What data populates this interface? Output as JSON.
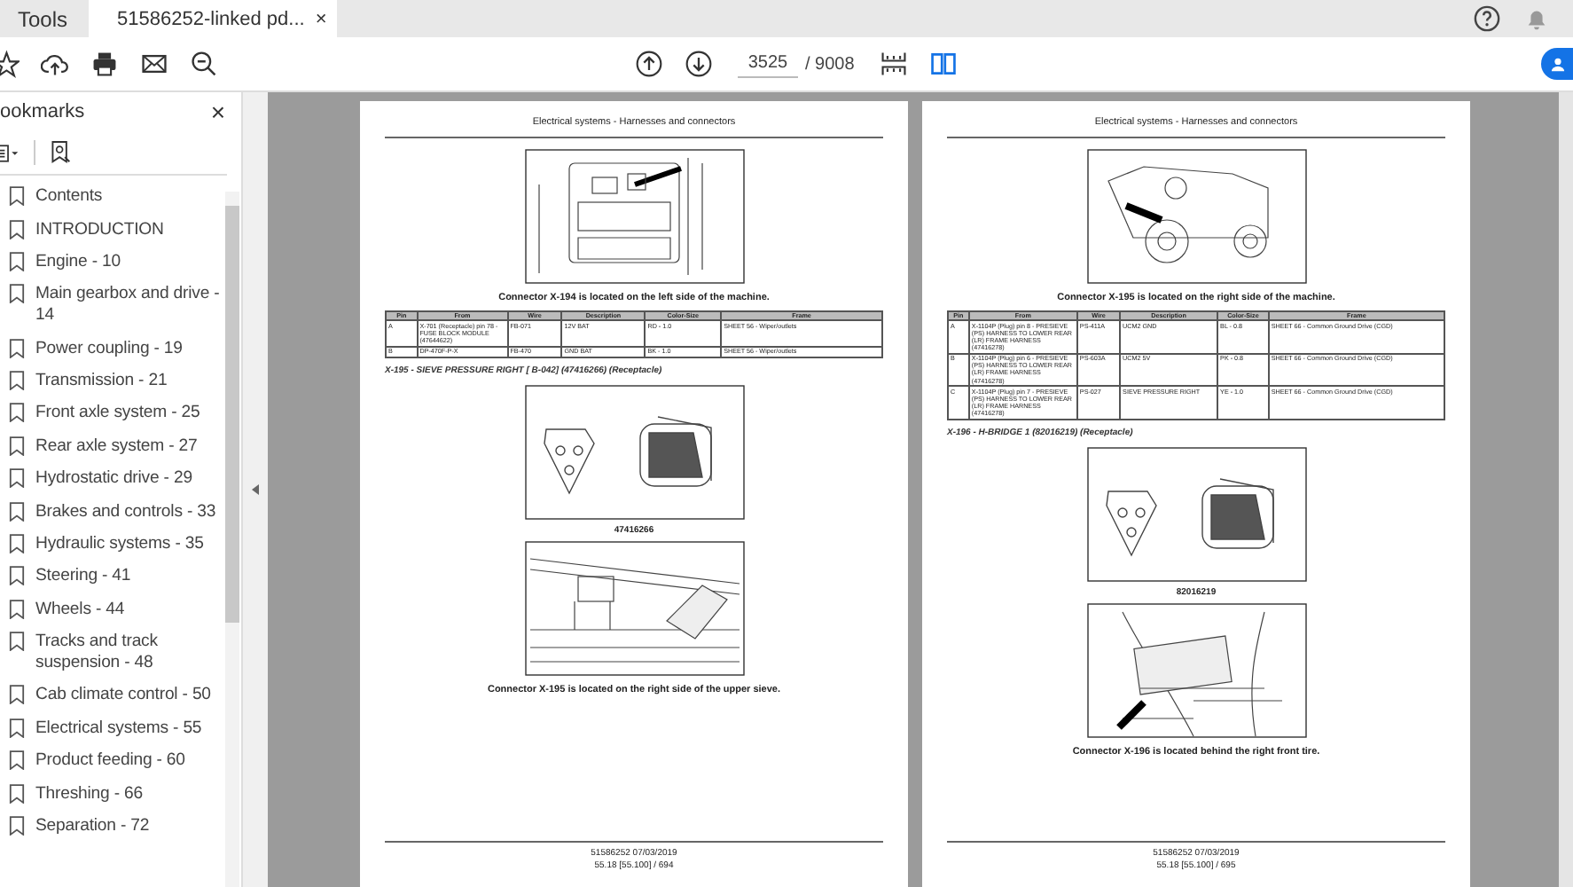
{
  "tabs": {
    "tools": "Tools",
    "document": {
      "title": "51586252-linked pd...",
      "close": "×",
      "selected": true
    }
  },
  "toolbar": {
    "page_current": "3525",
    "page_total": "/ 9008"
  },
  "sidebar": {
    "title": "ookmarks",
    "close": "×",
    "items": [
      {
        "label": "Contents"
      },
      {
        "label": "INTRODUCTION"
      },
      {
        "label": "Engine - 10"
      },
      {
        "label": "Main gearbox and drive - 14"
      },
      {
        "label": "Power coupling - 19"
      },
      {
        "label": "Transmission - 21"
      },
      {
        "label": "Front axle system - 25"
      },
      {
        "label": "Rear axle system - 27"
      },
      {
        "label": "Hydrostatic drive - 29"
      },
      {
        "label": "Brakes and controls - 33"
      },
      {
        "label": "Hydraulic systems - 35"
      },
      {
        "label": "Steering - 41"
      },
      {
        "label": "Wheels - 44"
      },
      {
        "label": "Tracks and track suspension - 48"
      },
      {
        "label": "Cab climate control - 50"
      },
      {
        "label": "Electrical systems - 55"
      },
      {
        "label": "Product feeding - 60"
      },
      {
        "label": "Threshing - 66"
      },
      {
        "label": "Separation - 72"
      }
    ]
  },
  "pages": [
    {
      "header": "Electrical systems - Harnesses and connectors",
      "blocks": [
        {
          "kind": "figure"
        },
        {
          "kind": "caption",
          "text": "Connector X-194 is located on the left side of the machine."
        },
        {
          "kind": "table",
          "columns": [
            "Pin",
            "From",
            "Wire",
            "Description",
            "Color-Size",
            "Frame"
          ],
          "rows": [
            [
              "A",
              "X-701 (Receptacle) pin 78 - FUSE BLOCK MODULE (47644622)",
              "FB-071",
              "12V BAT",
              "RD - 1.0",
              "SHEET 56 - Wiper/outlets"
            ],
            [
              "B",
              "DP-470F-P-X",
              "FB-470",
              "GND BAT",
              "BK - 1.0",
              "SHEET 56 - Wiper/outlets"
            ]
          ]
        },
        {
          "kind": "heading",
          "text": "X-195 - SIEVE PRESSURE RIGHT [ B-042] (47416266) (Receptacle)"
        },
        {
          "kind": "figure"
        },
        {
          "kind": "code",
          "text": "47416266"
        },
        {
          "kind": "figure"
        },
        {
          "kind": "caption",
          "text": "Connector X-195 is located on the right side of the upper sieve."
        }
      ],
      "footer": [
        "51586252 07/03/2019",
        "55.18 [55.100] / 694"
      ]
    },
    {
      "header": "Electrical systems - Harnesses and connectors",
      "blocks": [
        {
          "kind": "figure"
        },
        {
          "kind": "caption",
          "text": "Connector X-195 is located on the right side of the machine."
        },
        {
          "kind": "table",
          "columns": [
            "Pin",
            "From",
            "Wire",
            "Description",
            "Color-Size",
            "Frame"
          ],
          "rows": [
            [
              "A",
              "X-1104P (Plug) pin 8 - PRESIEVE (PS) HARNESS TO LOWER REAR (LR) FRAME HARNESS (47416278)",
              "PS-411A",
              "UCM2 GND",
              "BL - 0.8",
              "SHEET 66 - Common Ground Drive (CGD)"
            ],
            [
              "B",
              "X-1104P (Plug) pin 6 - PRESIEVE (PS) HARNESS TO LOWER REAR (LR) FRAME HARNESS (47416278)",
              "PS-603A",
              "UCM2 5V",
              "PK - 0.8",
              "SHEET 66 - Common Ground Drive (CGD)"
            ],
            [
              "C",
              "X-1104P (Plug) pin 7 - PRESIEVE (PS) HARNESS TO LOWER REAR (LR) FRAME HARNESS (47416278)",
              "PS-027",
              "SIEVE PRESSURE RIGHT",
              "YE - 1.0",
              "SHEET 66 - Common Ground Drive (CGD)"
            ]
          ]
        },
        {
          "kind": "heading",
          "text": "X-196 - H-BRIDGE 1 (82016219) (Receptacle)"
        },
        {
          "kind": "figure"
        },
        {
          "kind": "code",
          "text": "82016219"
        },
        {
          "kind": "figure"
        },
        {
          "kind": "caption",
          "text": "Connector X-196 is located behind the right front tire."
        }
      ],
      "footer": [
        "51586252 07/03/2019",
        "55.18 [55.100] / 695"
      ]
    }
  ]
}
